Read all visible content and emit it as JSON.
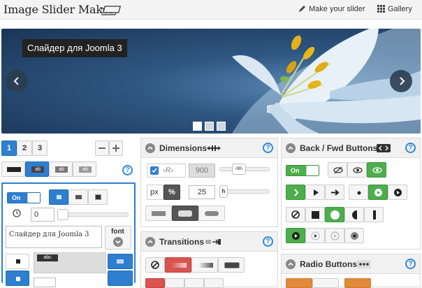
{
  "header": {
    "logo_text": "Image Slider Maker",
    "nav": [
      {
        "label": "Make your slider",
        "icon": "pencil-icon"
      },
      {
        "label": "Gallery",
        "icon": "grid-icon"
      }
    ]
  },
  "slider": {
    "caption": "Слайдер для Joomla 3",
    "dots": [
      true,
      false,
      false
    ]
  },
  "left_panel": {
    "tabs": [
      "1",
      "2",
      "3"
    ],
    "on_label": "On",
    "delay_value": "0",
    "caption_text": "Слайдер для Joomla 3",
    "font_label": "font",
    "abc_label": "abc",
    "ab_labels": [
      "ab",
      "ab",
      "ab"
    ]
  },
  "dimensions": {
    "title": "Dimensions",
    "r_label": "R",
    "width_value": "900",
    "w_label": "W",
    "unit_px": "px",
    "unit_pct": "%",
    "height_value": "25",
    "h_label": "h"
  },
  "transitions": {
    "title": "Transitions"
  },
  "backfwd": {
    "title": "Back / Fwd Buttons",
    "on_label": "On"
  },
  "radio": {
    "title": "Radio Buttons"
  },
  "colors": {
    "accent_blue": "#2f7fd0",
    "accent_green": "#4cae4c",
    "accent_red": "#d9534f",
    "accent_orange": "#e08a3a"
  }
}
